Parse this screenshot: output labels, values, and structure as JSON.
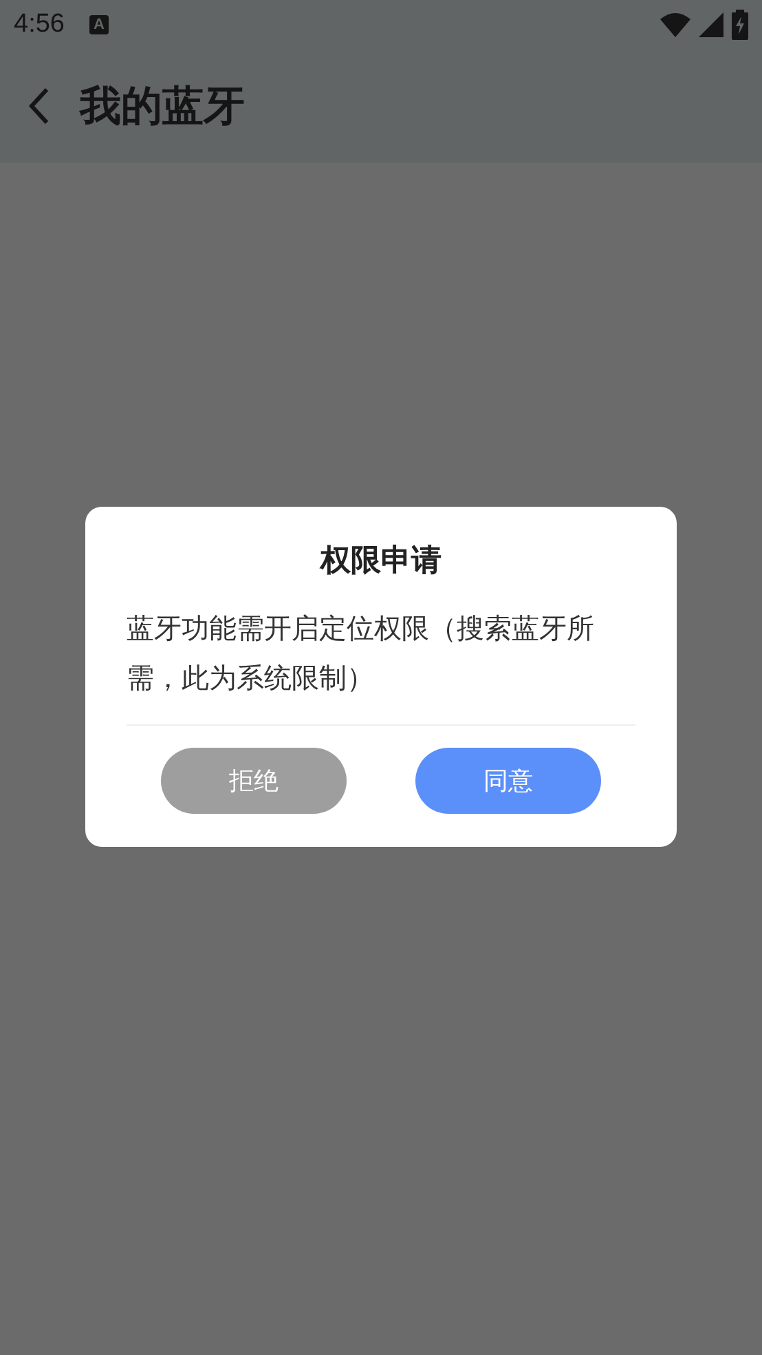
{
  "status_bar": {
    "time": "4:56",
    "notification_glyph": "A"
  },
  "header": {
    "title": "我的蓝牙"
  },
  "dialog": {
    "title": "权限申请",
    "message": "蓝牙功能需开启定位权限（搜索蓝牙所需，此为系统限制）",
    "buttons": [
      {
        "label": "拒绝",
        "kind": "secondary"
      },
      {
        "label": "同意",
        "kind": "primary"
      }
    ]
  }
}
